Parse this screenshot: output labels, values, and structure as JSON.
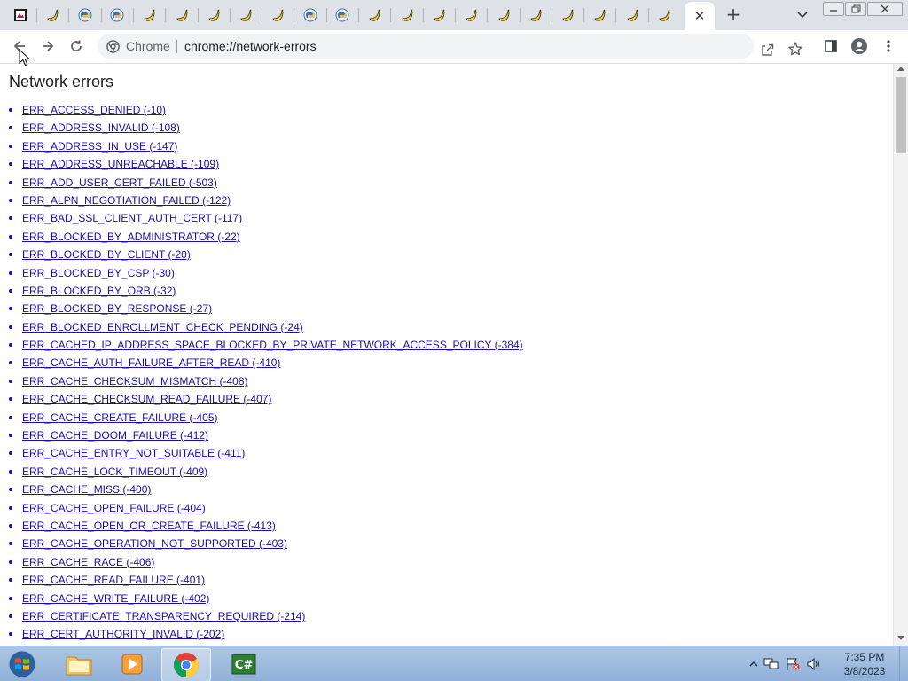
{
  "browser": {
    "tabs_bg": "#dee1e6",
    "tabs": [
      {
        "icon": "app-icon"
      },
      {
        "icon": "banana-icon"
      },
      {
        "icon": "python-icon"
      },
      {
        "icon": "python-icon"
      },
      {
        "icon": "banana-icon"
      },
      {
        "icon": "banana-icon"
      },
      {
        "icon": "banana-icon"
      },
      {
        "icon": "banana-icon"
      },
      {
        "icon": "banana-icon"
      },
      {
        "icon": "python-icon"
      },
      {
        "icon": "python-icon"
      },
      {
        "icon": "banana-icon"
      },
      {
        "icon": "banana-icon"
      },
      {
        "icon": "banana-icon"
      },
      {
        "icon": "banana-icon"
      },
      {
        "icon": "banana-icon"
      },
      {
        "icon": "banana-icon"
      },
      {
        "icon": "banana-icon"
      },
      {
        "icon": "banana-icon"
      },
      {
        "icon": "banana-icon"
      },
      {
        "icon": "banana-icon"
      }
    ],
    "active_tab_close": "✕",
    "new_tab": "+",
    "omnibox": {
      "chip_label": "Chrome",
      "url": "chrome://network-errors"
    }
  },
  "page": {
    "title": "Network errors",
    "link_color": "#1a0dab",
    "errors": [
      "ERR_ACCESS_DENIED (-10)",
      "ERR_ADDRESS_INVALID (-108)",
      "ERR_ADDRESS_IN_USE (-147)",
      "ERR_ADDRESS_UNREACHABLE (-109)",
      "ERR_ADD_USER_CERT_FAILED (-503)",
      "ERR_ALPN_NEGOTIATION_FAILED (-122)",
      "ERR_BAD_SSL_CLIENT_AUTH_CERT (-117)",
      "ERR_BLOCKED_BY_ADMINISTRATOR (-22)",
      "ERR_BLOCKED_BY_CLIENT (-20)",
      "ERR_BLOCKED_BY_CSP (-30)",
      "ERR_BLOCKED_BY_ORB (-32)",
      "ERR_BLOCKED_BY_RESPONSE (-27)",
      "ERR_BLOCKED_ENROLLMENT_CHECK_PENDING (-24)",
      "ERR_CACHED_IP_ADDRESS_SPACE_BLOCKED_BY_PRIVATE_NETWORK_ACCESS_POLICY (-384)",
      "ERR_CACHE_AUTH_FAILURE_AFTER_READ (-410)",
      "ERR_CACHE_CHECKSUM_MISMATCH (-408)",
      "ERR_CACHE_CHECKSUM_READ_FAILURE (-407)",
      "ERR_CACHE_CREATE_FAILURE (-405)",
      "ERR_CACHE_DOOM_FAILURE (-412)",
      "ERR_CACHE_ENTRY_NOT_SUITABLE (-411)",
      "ERR_CACHE_LOCK_TIMEOUT (-409)",
      "ERR_CACHE_MISS (-400)",
      "ERR_CACHE_OPEN_FAILURE (-404)",
      "ERR_CACHE_OPEN_OR_CREATE_FAILURE (-413)",
      "ERR_CACHE_OPERATION_NOT_SUPPORTED (-403)",
      "ERR_CACHE_RACE (-406)",
      "ERR_CACHE_READ_FAILURE (-401)",
      "ERR_CACHE_WRITE_FAILURE (-402)",
      "ERR_CERTIFICATE_TRANSPARENCY_REQUIRED (-214)",
      "ERR_CERT_AUTHORITY_INVALID (-202)"
    ]
  },
  "taskbar": {
    "items": [
      {
        "name": "file-explorer",
        "icon": "folder-icon"
      },
      {
        "name": "media-player",
        "icon": "media-player-icon"
      },
      {
        "name": "chrome",
        "icon": "chrome-icon",
        "active": true
      },
      {
        "name": "csharp-app",
        "icon": "csharp-icon"
      }
    ],
    "clock_time": "7:35 PM",
    "clock_date": "3/8/2023"
  }
}
